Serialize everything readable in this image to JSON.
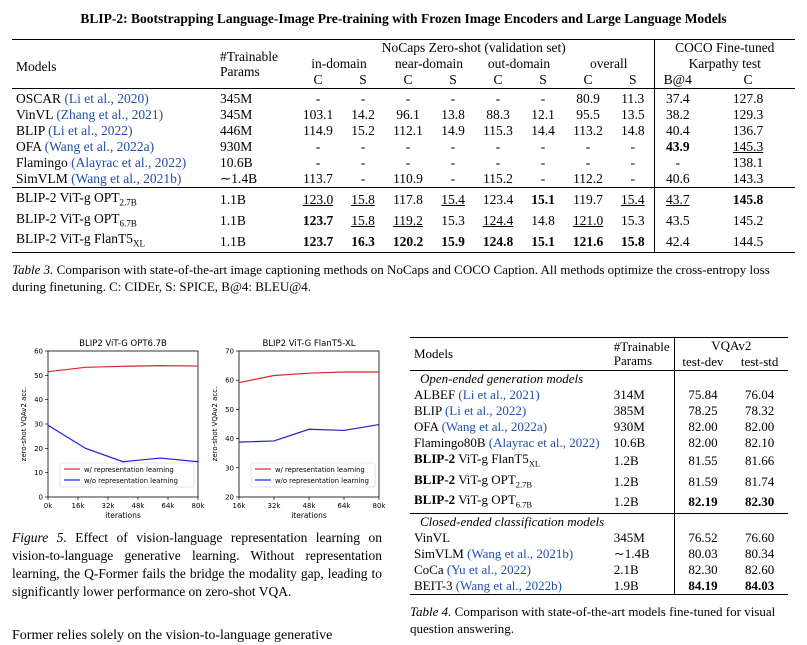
{
  "paper_header": "BLIP-2: Bootstrapping Language-Image Pre-training with Frozen Image Encoders and Large Language Models",
  "table3": {
    "header": {
      "models": "Models",
      "params_line1": "#Trainable",
      "params_line2": "Params",
      "nocaps": "NoCaps Zero-shot (validation set)",
      "coco_line1": "COCO Fine-tuned",
      "coco_line2": "Karpathy test",
      "groups": [
        "in-domain",
        "near-domain",
        "out-domain",
        "overall"
      ],
      "sub": [
        "C",
        "S",
        "C",
        "S",
        "C",
        "S",
        "C",
        "S",
        "B@4",
        "C"
      ]
    },
    "rows_top": [
      {
        "name": "OSCAR",
        "cite": "(Li et al., 2020)",
        "params": "345M",
        "cells": [
          "-",
          "-",
          "-",
          "-",
          "-",
          "-",
          "80.9",
          "11.3",
          "37.4",
          "127.8"
        ],
        "bold": [],
        "under": []
      },
      {
        "name": "VinVL",
        "cite": "(Zhang et al., 2021)",
        "params": "345M",
        "cells": [
          "103.1",
          "14.2",
          "96.1",
          "13.8",
          "88.3",
          "12.1",
          "95.5",
          "13.5",
          "38.2",
          "129.3"
        ],
        "bold": [],
        "under": []
      },
      {
        "name": "BLIP",
        "cite": "(Li et al., 2022)",
        "params": "446M",
        "cells": [
          "114.9",
          "15.2",
          "112.1",
          "14.9",
          "115.3",
          "14.4",
          "113.2",
          "14.8",
          "40.4",
          "136.7"
        ],
        "bold": [],
        "under": []
      },
      {
        "name": "OFA",
        "cite": "(Wang et al., 2022a)",
        "params": "930M",
        "cells": [
          "-",
          "-",
          "-",
          "-",
          "-",
          "-",
          "-",
          "-",
          "43.9",
          "145.3"
        ],
        "bold": [
          8
        ],
        "under": [
          9
        ]
      },
      {
        "name": "Flamingo",
        "cite": "(Alayrac et al., 2022)",
        "params": "10.6B",
        "cells": [
          "-",
          "-",
          "-",
          "-",
          "-",
          "-",
          "-",
          "-",
          "-",
          "138.1"
        ],
        "bold": [],
        "under": []
      },
      {
        "name": "SimVLM",
        "cite": "(Wang et al., 2021b)",
        "params": "∼1.4B",
        "cells": [
          "113.7",
          "-",
          "110.9",
          "-",
          "115.2",
          "-",
          "112.2",
          "-",
          "40.6",
          "143.3"
        ],
        "bold": [],
        "under": []
      }
    ],
    "rows_bottom": [
      {
        "name": "BLIP-2 ViT-g OPT",
        "sub": "2.7B",
        "params": "1.1B",
        "cells": [
          "123.0",
          "15.8",
          "117.8",
          "15.4",
          "123.4",
          "15.1",
          "119.7",
          "15.4",
          "43.7",
          "145.8"
        ],
        "bold": [
          5,
          9
        ],
        "under": [
          0,
          1,
          3,
          7,
          8
        ]
      },
      {
        "name": "BLIP-2 ViT-g OPT",
        "sub": "6.7B",
        "params": "1.1B",
        "cells": [
          "123.7",
          "15.8",
          "119.2",
          "15.3",
          "124.4",
          "14.8",
          "121.0",
          "15.3",
          "43.5",
          "145.2"
        ],
        "bold": [
          0
        ],
        "under": [
          1,
          2,
          4,
          6
        ]
      },
      {
        "name": "BLIP-2 ViT-g FlanT5",
        "sub": "XL",
        "params": "1.1B",
        "cells": [
          "123.7",
          "16.3",
          "120.2",
          "15.9",
          "124.8",
          "15.1",
          "121.6",
          "15.8",
          "42.4",
          "144.5"
        ],
        "bold": [
          0,
          1,
          2,
          3,
          4,
          5,
          6,
          7
        ],
        "under": []
      }
    ],
    "caption": "Table 3. Comparison with state-of-the-art image captioning methods on NoCaps and COCO Caption. All methods optimize the cross-entropy loss during finetuning. C: CIDEr, S: SPICE, B@4: BLEU@4."
  },
  "chart_data": [
    {
      "type": "line",
      "title": "BLIP2 ViT-G OPT6.7B",
      "xlabel": "iterations",
      "ylabel": "zero-shot VQAv2 acc.",
      "x": [
        "0k",
        "16k",
        "32k",
        "48k",
        "64k",
        "80k"
      ],
      "ylim": [
        0,
        60
      ],
      "yticks": [
        0,
        10,
        20,
        30,
        40,
        50,
        60
      ],
      "legend_position": "bottom-right",
      "series": [
        {
          "name": "w/ representation learning",
          "color": "#d62728",
          "values": [
            51.5,
            53.3,
            53.7,
            54.0,
            53.8
          ]
        },
        {
          "name": "w/o representation learning",
          "color": "#1f1fd6",
          "values": [
            29.5,
            20.0,
            14.5,
            16.0,
            14.5
          ]
        }
      ]
    },
    {
      "type": "line",
      "title": "BLIP2 ViT-G FlanT5-XL",
      "xlabel": "iterations",
      "ylabel": "zero-shot VQAv2 acc.",
      "x": [
        "16k",
        "32k",
        "48k",
        "64k",
        "80k"
      ],
      "ylim": [
        20,
        70
      ],
      "yticks": [
        20,
        30,
        40,
        50,
        60,
        70
      ],
      "legend_position": "bottom-right",
      "series": [
        {
          "name": "w/ representation learning",
          "color": "#d62728",
          "values": [
            59.2,
            61.6,
            62.4,
            62.8,
            62.8
          ]
        },
        {
          "name": "w/o representation learning",
          "color": "#1f1fd6",
          "values": [
            38.8,
            39.2,
            43.2,
            42.8,
            44.8
          ]
        }
      ]
    }
  ],
  "figure5_caption": "Figure 5. Effect of vision-language representation learning on vision-to-language generative learning. Without representation learning, the Q-Former fails the bridge the modality gap, leading to significantly lower performance on zero-shot VQA.",
  "body_fragment": "Former relies solely on the vision-to-language generative",
  "table4": {
    "header": {
      "models": "Models",
      "params_line1": "#Trainable",
      "params_line2": "Params",
      "vqa": "VQAv2",
      "test_dev": "test-dev",
      "test_std": "test-std"
    },
    "section1": "Open-ended generation models",
    "section2": "Closed-ended classification models",
    "rows1": [
      {
        "name": "ALBEF",
        "cite": "(Li et al., 2021)",
        "params": "314M",
        "dev": "75.84",
        "std": "76.04",
        "bold": []
      },
      {
        "name": "BLIP",
        "cite": "(Li et al., 2022)",
        "params": "385M",
        "dev": "78.25",
        "std": "78.32",
        "bold": []
      },
      {
        "name": "OFA",
        "cite": "(Wang et al., 2022a)",
        "params": "930M",
        "dev": "82.00",
        "std": "82.00",
        "bold": []
      },
      {
        "name": "Flamingo80B",
        "cite": "(Alayrac et al., 2022)",
        "params": "10.6B",
        "dev": "82.00",
        "std": "82.10",
        "bold": []
      },
      {
        "name": "BLIP-2",
        "rest": "ViT-g FlanT5",
        "sub": "XL",
        "params": "1.2B",
        "dev": "81.55",
        "std": "81.66",
        "bold": []
      },
      {
        "name": "BLIP-2",
        "rest": "ViT-g OPT",
        "sub": "2.7B",
        "params": "1.2B",
        "dev": "81.59",
        "std": "81.74",
        "bold": []
      },
      {
        "name": "BLIP-2",
        "rest": "ViT-g OPT",
        "sub": "6.7B",
        "params": "1.2B",
        "dev": "82.19",
        "std": "82.30",
        "bold": [
          "dev",
          "std"
        ]
      }
    ],
    "rows2": [
      {
        "name": "VinVL",
        "cite": "",
        "params": "345M",
        "dev": "76.52",
        "std": "76.60",
        "bold": []
      },
      {
        "name": "SimVLM",
        "cite": "(Wang et al., 2021b)",
        "params": "∼1.4B",
        "dev": "80.03",
        "std": "80.34",
        "bold": []
      },
      {
        "name": "CoCa",
        "cite": "(Yu et al., 2022)",
        "params": "2.1B",
        "dev": "82.30",
        "std": "82.60",
        "bold": []
      },
      {
        "name": "BEIT-3",
        "cite": "(Wang et al., 2022b)",
        "params": "1.9B",
        "dev": "84.19",
        "std": "84.03",
        "bold": [
          "dev",
          "std"
        ]
      }
    ],
    "caption": "Table 4. Comparison with state-of-the-art models fine-tuned for visual question answering."
  }
}
